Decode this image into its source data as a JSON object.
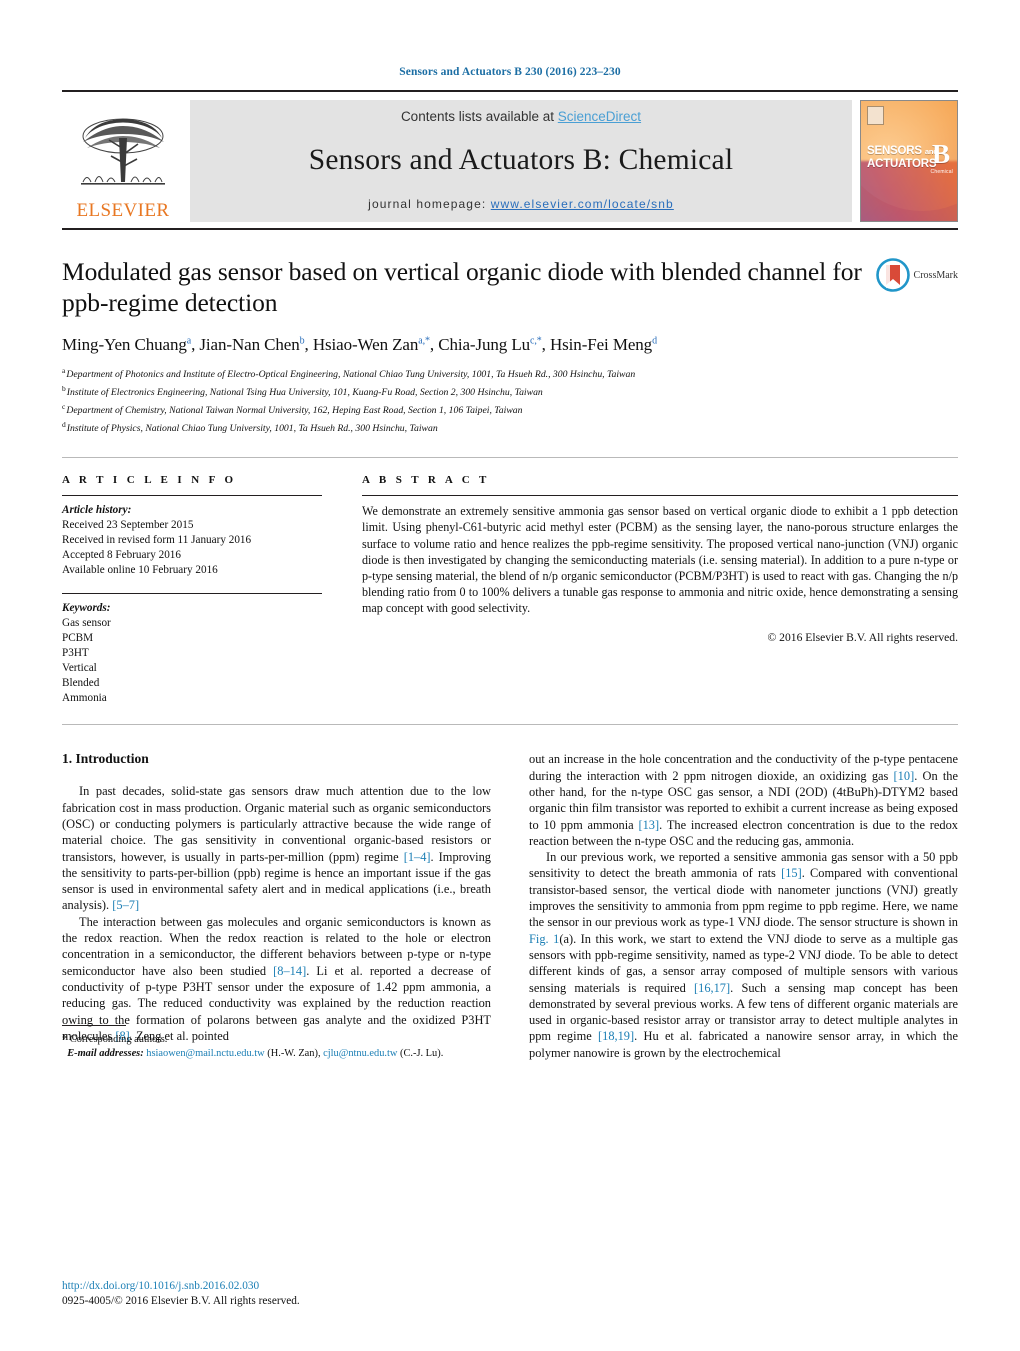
{
  "running_head": "Sensors and Actuators B 230 (2016) 223–230",
  "masthead": {
    "contents_prefix": "Contents lists available at ",
    "sciencedirect": "ScienceDirect",
    "journal_title": "Sensors and Actuators B: Chemical",
    "homepage_prefix": "journal homepage: ",
    "homepage_url": "www.elsevier.com/locate/snb",
    "publisher": "ELSEVIER",
    "cover": {
      "line1": "SENSORS",
      "line1_small": "and",
      "line2": "ACTUATORS",
      "letter": "B",
      "letter_sub": "Chemical"
    }
  },
  "article": {
    "title": "Modulated gas sensor based on vertical organic diode with blended channel for ppb-regime detection",
    "crossmark_label": "CrossMark",
    "authors_html": "Ming-Yen Chuang<sup>a</sup>, Jian-Nan Chen<sup>b</sup>, Hsiao-Wen Zan<sup>a,*</sup>, Chia-Jung Lu<sup>c,*</sup>, Hsin-Fei Meng<sup>d</sup>",
    "affiliations": [
      {
        "marker": "a",
        "text": "Department of Photonics and Institute of Electro-Optical Engineering, National Chiao Tung University, 1001, Ta Hsueh Rd., 300 Hsinchu, Taiwan"
      },
      {
        "marker": "b",
        "text": "Institute of Electronics Engineering, National Tsing Hua University, 101, Kuang-Fu Road, Section 2, 300 Hsinchu, Taiwan"
      },
      {
        "marker": "c",
        "text": "Department of Chemistry, National Taiwan Normal University, 162, Heping East Road, Section 1, 106 Taipei, Taiwan"
      },
      {
        "marker": "d",
        "text": "Institute of Physics, National Chiao Tung University, 1001, Ta Hsueh Rd., 300 Hsinchu, Taiwan"
      }
    ]
  },
  "article_info": {
    "heading": "A R T I C L E   I N F O",
    "history_label": "Article history:",
    "history": [
      "Received 23 September 2015",
      "Received in revised form 11 January 2016",
      "Accepted 8 February 2016",
      "Available online 10 February 2016"
    ],
    "keywords_label": "Keywords:",
    "keywords": [
      "Gas sensor",
      "PCBM",
      "P3HT",
      "Vertical",
      "Blended",
      "Ammonia"
    ]
  },
  "abstract": {
    "heading": "A B S T R A C T",
    "text": "We demonstrate an extremely sensitive ammonia gas sensor based on vertical organic diode to exhibit a 1 ppb detection limit. Using phenyl-C61-butyric acid methyl ester (PCBM) as the sensing layer, the nano-porous structure enlarges the surface to volume ratio and hence realizes the ppb-regime sensitivity. The proposed vertical nano-junction (VNJ) organic diode is then investigated by changing the semiconducting materials (i.e. sensing material). In addition to a pure n-type or p-type sensing material, the blend of n/p organic semiconductor (PCBM/P3HT) is used to react with gas. Changing the n/p blending ratio from 0 to 100% delivers a tunable gas response to ammonia and nitric oxide, hence demonstrating a sensing map concept with good selectivity.",
    "copyright": "© 2016 Elsevier B.V. All rights reserved."
  },
  "body": {
    "section_title": "1.  Introduction",
    "left_paragraphs": [
      "In past decades, solid-state gas sensors draw much attention due to the low fabrication cost in mass production. Organic material such as organic semiconductors (OSC) or conducting polymers is particularly attractive because the wide range of material choice. The gas sensitivity in conventional organic-based resistors or transistors, however, is usually in parts-per-million (ppm) regime [1–4]. Improving the sensitivity to parts-per-billion (ppb) regime is hence an important issue if the gas sensor is used in environmental safety alert and in medical applications (i.e., breath analysis). [5–7]",
      "The interaction between gas molecules and organic semiconductors is known as the redox reaction. When the redox reaction is related to the hole or electron concentration in a semiconductor, the different behaviors between p-type or n-type semiconductor have also been studied [8–14]. Li et al. reported a decrease of conductivity of p-type P3HT sensor under the exposure of 1.42 ppm ammonia, a reducing gas. The reduced conductivity was explained by the reduction reaction owing to the formation of polarons between gas analyte and the oxidized P3HT molecules [8]. Zeng et al. pointed"
    ],
    "right_paragraphs": [
      "out an increase in the hole concentration and the conductivity of the p-type pentacene during the interaction with 2 ppm nitrogen dioxide, an oxidizing gas [10]. On the other hand, for the n-type OSC gas sensor, a NDI (2OD) (4tBuPh)-DTYM2 based organic thin film transistor was reported to exhibit a current increase as being exposed to 10 ppm ammonia [13]. The increased electron concentration is due to the redox reaction between the n-type OSC and the reducing gas, ammonia.",
      "In our previous work, we reported a sensitive ammonia gas sensor with a 50 ppb sensitivity to detect the breath ammonia of rats [15]. Compared with conventional transistor-based sensor, the vertical diode with nanometer junctions (VNJ) greatly improves the sensitivity to ammonia from ppm regime to ppb regime. Here, we name the sensor in our previous work as type-1 VNJ diode. The sensor structure is shown in Fig. 1(a). In this work, we start to extend the VNJ diode to serve as a multiple gas sensors with ppb-regime sensitivity, named as type-2 VNJ diode. To be able to detect different kinds of gas, a sensor array composed of multiple sensors with various sensing materials is required [16,17]. Such a sensing map concept has been demonstrated by several previous works. A few tens of different organic materials are used in organic-based resistor array or transistor array to detect multiple analytes in ppm regime [18,19]. Hu et al. fabricated a nanowire sensor array, in which the polymer nanowire is grown by the electrochemical"
    ]
  },
  "footnotes": {
    "corresponding": "*  Corresponding authors.",
    "email_label": "E-mail addresses:",
    "email1": "hsiaowen@mail.nctu.edu.tw",
    "email1_owner": "(H.-W. Zan),",
    "email2": "cjlu@ntnu.edu.tw",
    "email2_owner": "(C.-J. Lu)."
  },
  "footer": {
    "doi": "http://dx.doi.org/10.1016/j.snb.2016.02.030",
    "issn_line": "0925-4005/© 2016 Elsevier B.V. All rights reserved."
  },
  "colors": {
    "link": "#1c7fb5",
    "header_blue": "#1c6ea4",
    "elsevier_orange": "#e87722",
    "masthead_gray": "#e3e3e3"
  }
}
